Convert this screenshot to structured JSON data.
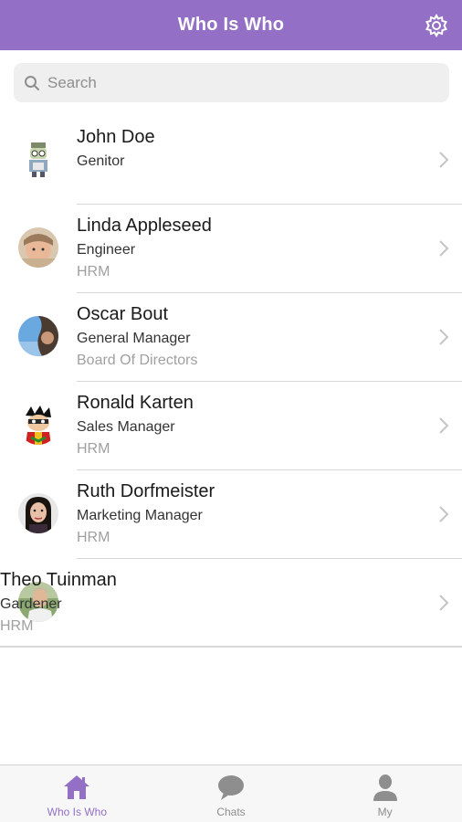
{
  "header": {
    "title": "Who Is Who",
    "accent_color": "#9370c5"
  },
  "search": {
    "placeholder": "Search"
  },
  "contacts": [
    {
      "name": "John Doe",
      "title": "Genitor",
      "department": ""
    },
    {
      "name": "Linda Appleseed",
      "title": "Engineer",
      "department": "HRM"
    },
    {
      "name": "Oscar Bout",
      "title": "General Manager",
      "department": "Board Of Directors"
    },
    {
      "name": "Ronald Karten",
      "title": "Sales Manager",
      "department": "HRM"
    },
    {
      "name": "Ruth Dorfmeister",
      "title": "Marketing Manager",
      "department": "HRM"
    },
    {
      "name": "Theo Tuinman",
      "title": "Gardener",
      "department": "HRM"
    }
  ],
  "tabbar": {
    "tabs": [
      {
        "label": "Who Is Who",
        "icon": "home-icon",
        "active": true
      },
      {
        "label": "Chats",
        "icon": "chat-bubble-icon",
        "active": false
      },
      {
        "label": "My",
        "icon": "person-icon",
        "active": false
      }
    ]
  }
}
